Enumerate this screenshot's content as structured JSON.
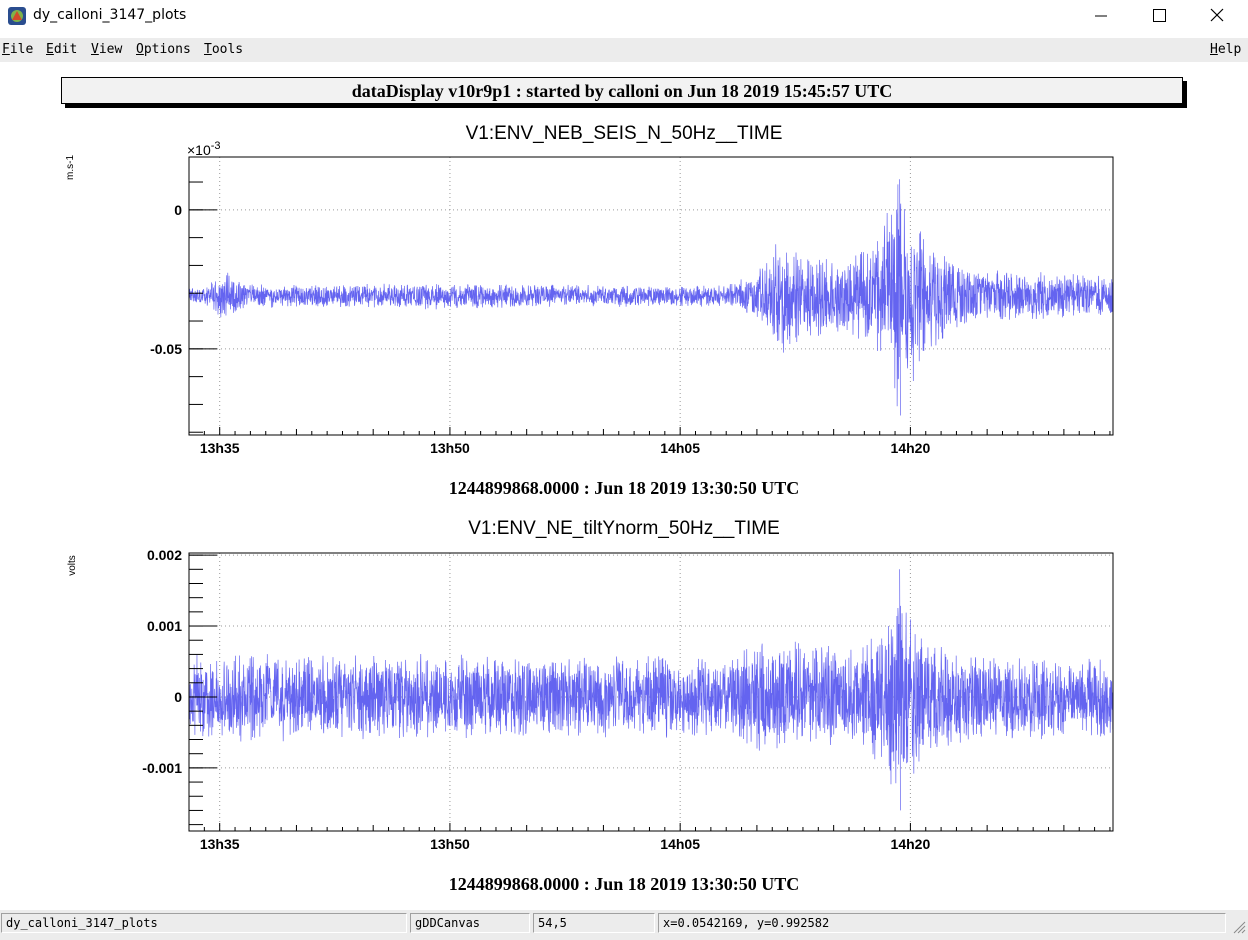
{
  "window": {
    "title": "dy_calloni_3147_plots",
    "icon": "root-app-icon"
  },
  "menu": {
    "items": [
      {
        "label": "File",
        "u": "F",
        "rest": "ile"
      },
      {
        "label": "Edit",
        "u": "E",
        "rest": "dit"
      },
      {
        "label": "View",
        "u": "V",
        "rest": "iew"
      },
      {
        "label": "Options",
        "u": "O",
        "rest": "ptions"
      },
      {
        "label": "Tools",
        "u": "T",
        "rest": "ools"
      }
    ],
    "help": {
      "label": "Help",
      "u": "H",
      "rest": "elp"
    }
  },
  "canvas": {
    "header": "dataDisplay v10r9p1 : started by calloni on Jun 18 2019 15:45:57 UTC"
  },
  "status": {
    "canvas_name": "dy_calloni_3147_plots",
    "object": "gDDCanvas",
    "pixel": "54,5",
    "coords": "x=0.0542169, y=0.992582"
  },
  "chart_data": [
    {
      "type": "line",
      "title": "V1:ENV_NEB_SEIS_N_50Hz__TIME",
      "ylabel": "m.s-1",
      "y_multiplier": "×10",
      "y_exponent": "-3",
      "xlabel": "1244899868.0000 : Jun 18 2019 13:30:50 UTC",
      "x_unit": "minutes",
      "xlim": [
        13.5,
        13.4
      ],
      "x_range_clock": [
        "13:33",
        "14:33"
      ],
      "x_ticks": [
        {
          "t": 35,
          "label": "13h35"
        },
        {
          "t": 50,
          "label": "13h50"
        },
        {
          "t": 65,
          "label": "14h05"
        },
        {
          "t": 80,
          "label": "14h20"
        }
      ],
      "y_ticks": [
        {
          "v": 0,
          "label": "0"
        },
        {
          "v": -0.05,
          "label": "-0.05"
        }
      ],
      "ylim": [
        -0.081,
        0.019
      ],
      "color": "#6464f0",
      "grid": true,
      "series": {
        "baseline": -0.031,
        "envelope": [
          {
            "t": 33.0,
            "a": 0.003
          },
          {
            "t": 34.0,
            "a": 0.003
          },
          {
            "t": 35.3,
            "a": 0.01
          },
          {
            "t": 36.5,
            "a": 0.005
          },
          {
            "t": 40.0,
            "a": 0.004
          },
          {
            "t": 48.0,
            "a": 0.005
          },
          {
            "t": 60.0,
            "a": 0.004
          },
          {
            "t": 66.0,
            "a": 0.004
          },
          {
            "t": 68.0,
            "a": 0.004
          },
          {
            "t": 70.0,
            "a": 0.009
          },
          {
            "t": 71.5,
            "a": 0.022
          },
          {
            "t": 73.0,
            "a": 0.016
          },
          {
            "t": 75.5,
            "a": 0.014
          },
          {
            "t": 77.5,
            "a": 0.02
          },
          {
            "t": 79.3,
            "a": 0.044
          },
          {
            "t": 81.0,
            "a": 0.022
          },
          {
            "t": 84.0,
            "a": 0.01
          },
          {
            "t": 93.0,
            "a": 0.008
          }
        ],
        "min": -0.074,
        "max": 0.011
      }
    },
    {
      "type": "line",
      "title": "V1:ENV_NE_tiltYnorm_50Hz__TIME",
      "ylabel": "volts",
      "xlabel": "1244899868.0000 : Jun 18 2019 13:30:50 UTC",
      "x_unit": "minutes",
      "x_ticks": [
        {
          "t": 35,
          "label": "13h35"
        },
        {
          "t": 50,
          "label": "13h50"
        },
        {
          "t": 65,
          "label": "14h05"
        },
        {
          "t": 80,
          "label": "14h20"
        }
      ],
      "y_ticks": [
        {
          "v": 0.002,
          "label": "0.002"
        },
        {
          "v": 0.001,
          "label": "0.001"
        },
        {
          "v": 0,
          "label": "0"
        },
        {
          "v": -0.001,
          "label": "-0.001"
        }
      ],
      "ylim": [
        -0.00189,
        0.00203
      ],
      "color": "#6464f0",
      "grid": true,
      "series": {
        "baseline": 0,
        "envelope": [
          {
            "t": 33.0,
            "a": 0.00065
          },
          {
            "t": 40.0,
            "a": 0.00065
          },
          {
            "t": 60.0,
            "a": 0.0006
          },
          {
            "t": 68.0,
            "a": 0.0006
          },
          {
            "t": 71.5,
            "a": 0.00095
          },
          {
            "t": 73.0,
            "a": 0.0008
          },
          {
            "t": 76.5,
            "a": 0.0007
          },
          {
            "t": 79.3,
            "a": 0.00155
          },
          {
            "t": 81.0,
            "a": 0.00085
          },
          {
            "t": 84.0,
            "a": 0.00065
          },
          {
            "t": 93.0,
            "a": 0.0006
          }
        ],
        "min": -0.0016,
        "max": 0.0018
      }
    }
  ]
}
